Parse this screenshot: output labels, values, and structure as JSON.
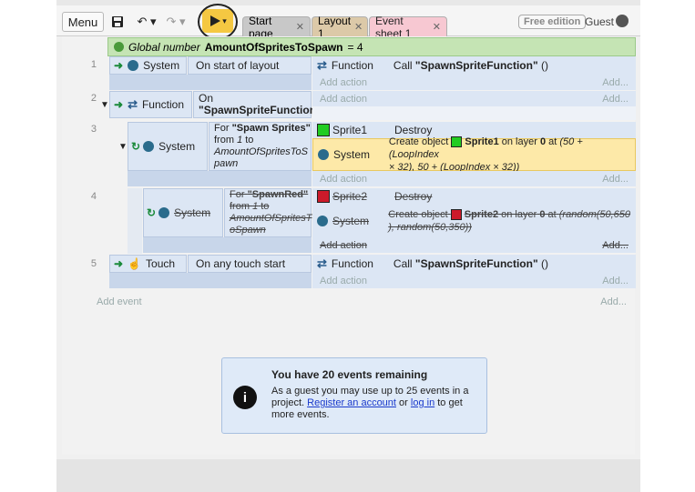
{
  "toolbar": {
    "menu_label": "Menu",
    "tabs": [
      {
        "label": "Start page"
      },
      {
        "label": "Layout 1"
      },
      {
        "label": "Event sheet 1"
      }
    ],
    "free_badge": "Free edition",
    "guest_label": "Guest"
  },
  "global_var": {
    "prefix": "Global number",
    "name": "AmountOfSpritesToSpawn",
    "value": "= 4"
  },
  "events": [
    {
      "number": "1",
      "object": "System",
      "condition": "On start of layout",
      "action_object": "Function",
      "action": "Call",
      "action_arg": "\"SpawnSpriteFunction\"",
      "action_tail": "()"
    },
    {
      "number": "2",
      "object": "Function",
      "condition_line1": "On",
      "condition_line2": "\"SpawnSpriteFunction\""
    },
    {
      "number": "3",
      "object": "System",
      "cond_prefix": "For",
      "cond_name": "\"Spawn Sprites\"",
      "cond_from": "from",
      "cond_start": "1",
      "cond_to": "to",
      "cond_end_line1": "AmountOfSpritesToS",
      "cond_end_line2": "pawn",
      "act1_object": "Sprite1",
      "act1": "Destroy",
      "act2_object": "System",
      "act2_prefix": "Create object",
      "act2_sprite": "Sprite1",
      "act2_on": "on layer",
      "act2_layer": "0",
      "act2_at": "at",
      "act2_expr1": "(50 + (LoopIndex",
      "act2_expr2": "× 32), 50 + (LoopIndex × 32))"
    },
    {
      "number": "4",
      "object": "System",
      "cond_prefix": "For",
      "cond_name": "\"SpawnRed\"",
      "cond_from": "from",
      "cond_start": "1",
      "cond_to": "to",
      "cond_end_line1": "AmountOfSpritesT",
      "cond_end_line2": "oSpawn",
      "act1_object": "Sprite2",
      "act1": "Destroy",
      "act2_object": "System",
      "act2_prefix": "Create object",
      "act2_sprite": "Sprite2",
      "act2_on": "on layer",
      "act2_layer": "0",
      "act2_at": "at",
      "act2_expr1": "(random(50,650",
      "act2_expr2": "), random(50,350))"
    },
    {
      "number": "5",
      "object": "Touch",
      "condition": "On any touch start",
      "action_object": "Function",
      "action": "Call",
      "action_arg": "\"SpawnSpriteFunction\"",
      "action_tail": "()"
    }
  ],
  "add_action": "Add action",
  "add_ellipsis": "Add...",
  "add_event": "Add event",
  "notice": {
    "title": "You have 20 events remaining",
    "body_pre": "As a guest you may use up to 25 events in a project.",
    "register_link": "Register an account",
    "or": "or",
    "login_link": "log in",
    "body_post": "to get more events."
  },
  "colors": {
    "global_bg": "#c5e4b4",
    "condition_bg": "#dce6f4",
    "highlight_bg": "#fde9a8",
    "play_button": "#f5c842",
    "tab_active": "#f7c8d2"
  }
}
